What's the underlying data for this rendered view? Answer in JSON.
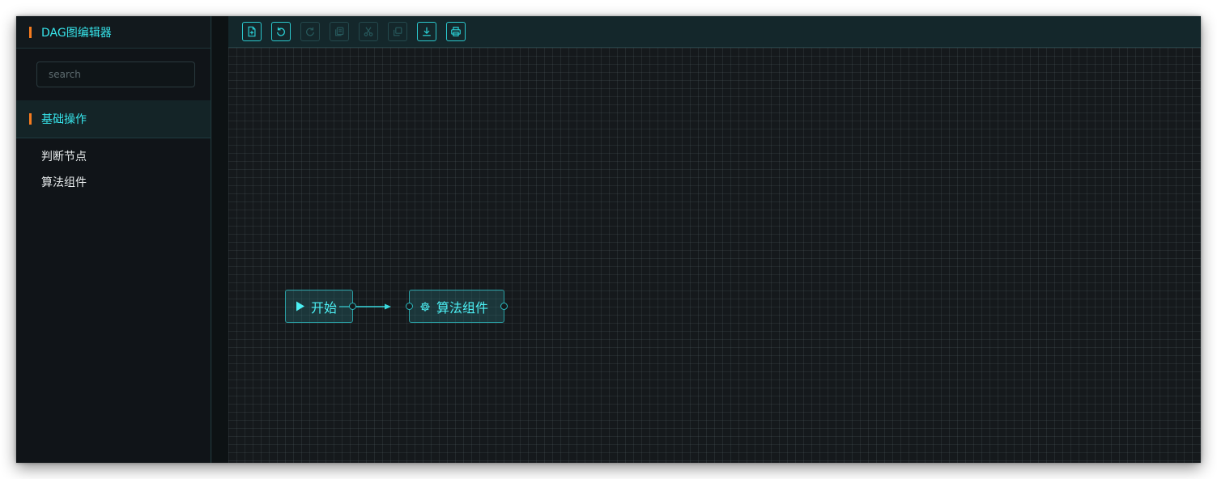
{
  "sidebar": {
    "title": "DAG图编辑器",
    "search": {
      "placeholder": "search",
      "value": ""
    },
    "group": {
      "title": "基础操作",
      "items": [
        {
          "label": "判断节点"
        },
        {
          "label": "算法组件"
        }
      ]
    }
  },
  "toolbar": {
    "buttons": [
      {
        "name": "new-file",
        "icon": "file-plus-icon",
        "enabled": true
      },
      {
        "name": "undo",
        "icon": "undo-icon",
        "enabled": true
      },
      {
        "name": "redo",
        "icon": "redo-icon",
        "enabled": false
      },
      {
        "name": "copy",
        "icon": "copy-icon",
        "enabled": false
      },
      {
        "name": "cut",
        "icon": "scissors-icon",
        "enabled": false
      },
      {
        "name": "paste",
        "icon": "paste-icon",
        "enabled": false
      },
      {
        "name": "download",
        "icon": "download-icon",
        "enabled": true
      },
      {
        "name": "print",
        "icon": "printer-icon",
        "enabled": true
      }
    ]
  },
  "canvas": {
    "nodes": [
      {
        "id": "start",
        "label": "开始",
        "icon": "play-icon"
      },
      {
        "id": "algo",
        "label": "算法组件",
        "icon": "gear-icon"
      }
    ],
    "edges": [
      {
        "from": "start",
        "to": "algo"
      }
    ]
  },
  "colors": {
    "accent": "#f47b1f",
    "cyan": "#37e6ec",
    "canvas_bg": "#15191c"
  }
}
